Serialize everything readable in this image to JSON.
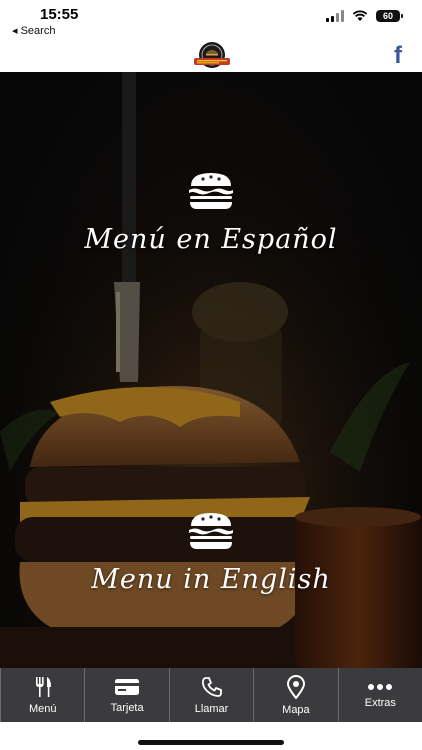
{
  "status_bar": {
    "time": "15:55",
    "back_label": "◂ Search",
    "battery": "60"
  },
  "header": {
    "logo_icon": "el-rincon-logo",
    "facebook_glyph": "f"
  },
  "main": {
    "menu_spanish": "Menú en Español",
    "menu_english": "Menu in English",
    "menu_icon": "burger-icon"
  },
  "tabs": [
    {
      "label": "Menú",
      "icon": "fork-knife-icon"
    },
    {
      "label": "Tarjeta",
      "icon": "card-icon"
    },
    {
      "label": "Llamar",
      "icon": "phone-icon"
    },
    {
      "label": "Mapa",
      "icon": "map-pin-icon"
    },
    {
      "label": "Extras",
      "icon": "more-icon"
    }
  ],
  "colors": {
    "tab_bar": "#3b3b3d",
    "facebook": "#3b5998",
    "text_light": "#ffffff"
  }
}
